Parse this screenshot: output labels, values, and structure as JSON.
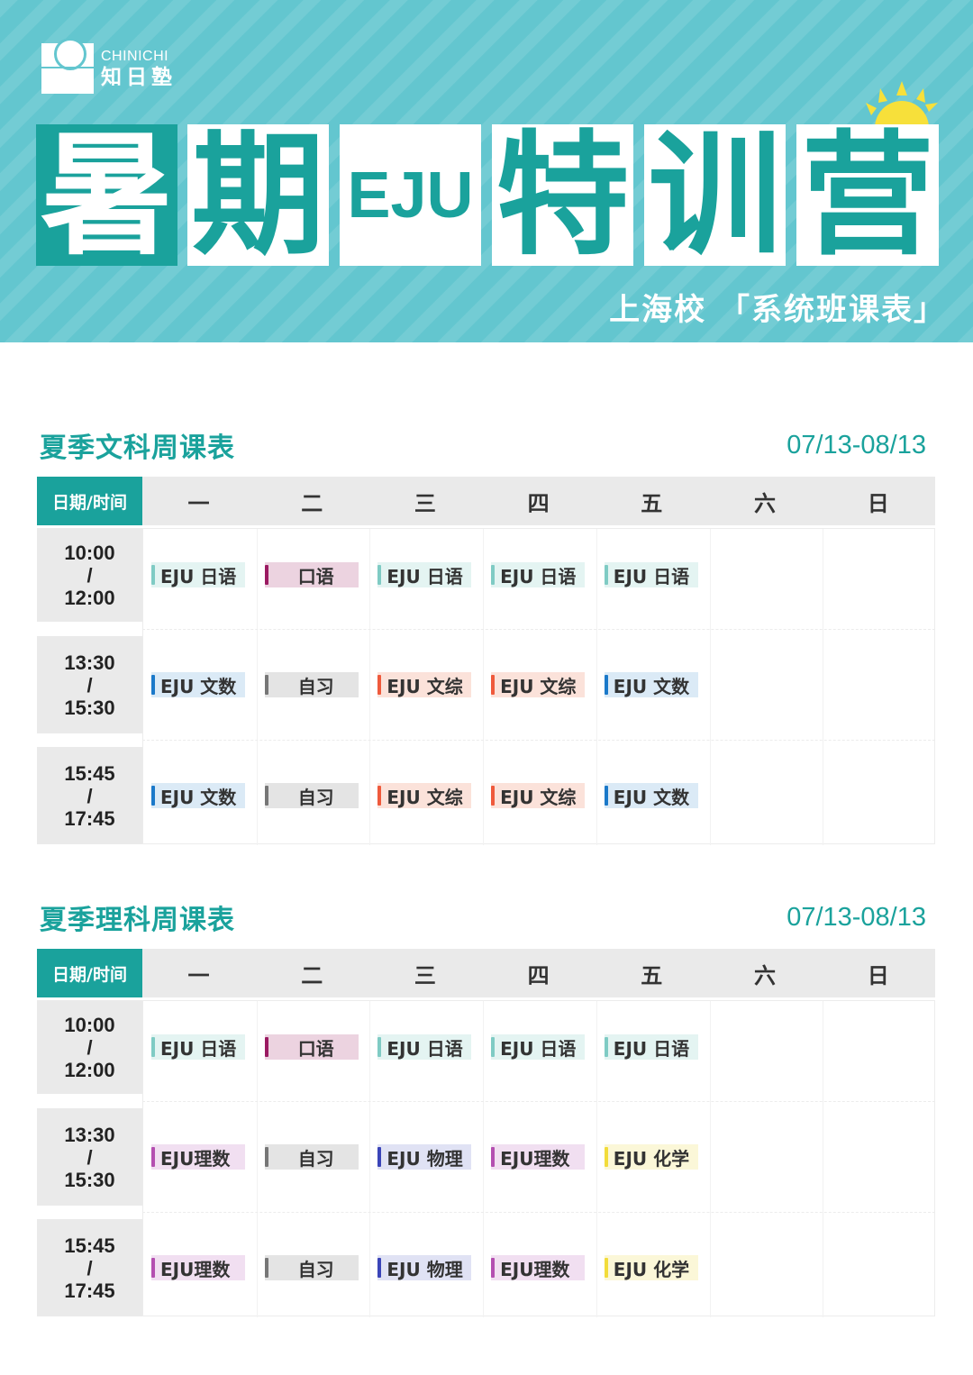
{
  "brand": {
    "name_en": "CHINICHI",
    "name_cn": "知日塾"
  },
  "title": {
    "chars": [
      "暑",
      "期",
      "EJU",
      "特",
      "训",
      "营"
    ],
    "subtitle": "上海校 「系统班课表」"
  },
  "colors": {
    "teal": "#1aa29c",
    "banner": "#63c6cf",
    "sun": "#f7e03a"
  },
  "sections": [
    {
      "title": "夏季文科周课表",
      "date_range": "07/13-08/13",
      "header": {
        "date_label": "日期/时间",
        "days": [
          "一",
          "二",
          "三",
          "四",
          "五",
          "六",
          "日"
        ]
      },
      "rows": [
        {
          "time": [
            "10:00",
            "/",
            "12:00"
          ],
          "cells": [
            {
              "label": "EJU 日语",
              "bar": "#7fcbc4",
              "bg": "#e4f4f2"
            },
            {
              "label": "口语",
              "bar": "#9b1b62",
              "bg": "#ecd3e0"
            },
            {
              "label": "EJU 日语",
              "bar": "#7fcbc4",
              "bg": "#e4f4f2"
            },
            {
              "label": "EJU 日语",
              "bar": "#7fcbc4",
              "bg": "#e4f4f2"
            },
            {
              "label": "EJU 日语",
              "bar": "#7fcbc4",
              "bg": "#e4f4f2"
            }
          ]
        },
        {
          "time": [
            "13:30",
            "/",
            "15:30"
          ],
          "cells": [
            {
              "label": "EJU 文数",
              "bar": "#1b79c9",
              "bg": "#dbeaf6"
            },
            {
              "label": "自习",
              "bar": "#777777",
              "bg": "#e4e4e4"
            },
            {
              "label": "EJU 文综",
              "bar": "#ef5a3c",
              "bg": "#fbe2da"
            },
            {
              "label": "EJU 文综",
              "bar": "#ef5a3c",
              "bg": "#fbe2da"
            },
            {
              "label": "EJU 文数",
              "bar": "#1b79c9",
              "bg": "#dbeaf6"
            }
          ]
        },
        {
          "time": [
            "15:45",
            "/",
            "17:45"
          ],
          "cells": [
            {
              "label": "EJU 文数",
              "bar": "#1b79c9",
              "bg": "#dbeaf6"
            },
            {
              "label": "自习",
              "bar": "#777777",
              "bg": "#e4e4e4"
            },
            {
              "label": "EJU 文综",
              "bar": "#ef5a3c",
              "bg": "#fbe2da"
            },
            {
              "label": "EJU 文综",
              "bar": "#ef5a3c",
              "bg": "#fbe2da"
            },
            {
              "label": "EJU 文数",
              "bar": "#1b79c9",
              "bg": "#dbeaf6"
            }
          ]
        }
      ]
    },
    {
      "title": "夏季理科周课表",
      "date_range": "07/13-08/13",
      "header": {
        "date_label": "日期/时间",
        "days": [
          "一",
          "二",
          "三",
          "四",
          "五",
          "六",
          "日"
        ]
      },
      "rows": [
        {
          "time": [
            "10:00",
            "/",
            "12:00"
          ],
          "cells": [
            {
              "label": "EJU 日语",
              "bar": "#7fcbc4",
              "bg": "#e4f4f2"
            },
            {
              "label": "口语",
              "bar": "#9b1b62",
              "bg": "#ecd3e0"
            },
            {
              "label": "EJU 日语",
              "bar": "#7fcbc4",
              "bg": "#e4f4f2"
            },
            {
              "label": "EJU 日语",
              "bar": "#7fcbc4",
              "bg": "#e4f4f2"
            },
            {
              "label": "EJU 日语",
              "bar": "#7fcbc4",
              "bg": "#e4f4f2"
            }
          ]
        },
        {
          "time": [
            "13:30",
            "/",
            "15:30"
          ],
          "cells": [
            {
              "label": "EJU理数",
              "bar": "#b44fb0",
              "bg": "#f1dff1"
            },
            {
              "label": "自习",
              "bar": "#777777",
              "bg": "#e4e4e4"
            },
            {
              "label": "EJU 物理",
              "bar": "#3a44b8",
              "bg": "#e0e2f4"
            },
            {
              "label": "EJU理数",
              "bar": "#b44fb0",
              "bg": "#f1dff1"
            },
            {
              "label": "EJU 化学",
              "bar": "#f2dc3a",
              "bg": "#fbf7d8"
            }
          ]
        },
        {
          "time": [
            "15:45",
            "/",
            "17:45"
          ],
          "cells": [
            {
              "label": "EJU理数",
              "bar": "#b44fb0",
              "bg": "#f1dff1"
            },
            {
              "label": "自习",
              "bar": "#777777",
              "bg": "#e4e4e4"
            },
            {
              "label": "EJU 物理",
              "bar": "#3a44b8",
              "bg": "#e0e2f4"
            },
            {
              "label": "EJU理数",
              "bar": "#b44fb0",
              "bg": "#f1dff1"
            },
            {
              "label": "EJU 化学",
              "bar": "#f2dc3a",
              "bg": "#fbf7d8"
            }
          ]
        }
      ]
    }
  ]
}
